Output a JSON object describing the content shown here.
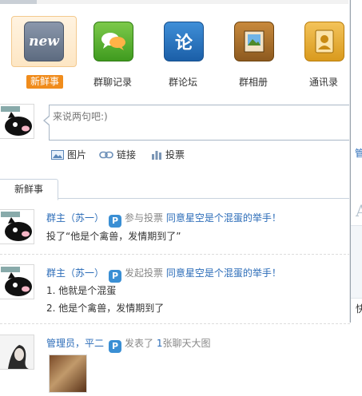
{
  "apps": [
    {
      "label": "新鲜事",
      "icon": "news-icon",
      "icon_text": "new",
      "active": true
    },
    {
      "label": "群聊记录",
      "icon": "chat-bubbles-icon",
      "active": false
    },
    {
      "label": "群论坛",
      "icon": "forum-icon",
      "icon_text": "论",
      "active": false
    },
    {
      "label": "群相册",
      "icon": "photo-album-icon",
      "active": false
    },
    {
      "label": "通讯录",
      "icon": "contacts-book-icon",
      "active": false
    }
  ],
  "composer": {
    "placeholder": "来说两句吧:)",
    "tools": [
      {
        "label": "图片",
        "icon": "image-icon"
      },
      {
        "label": "链接",
        "icon": "link-icon"
      },
      {
        "label": "投票",
        "icon": "poll-icon"
      }
    ]
  },
  "tabs": [
    {
      "label": "新鲜事",
      "active": true
    }
  ],
  "feed": [
    {
      "author": "群主（苏一）",
      "action": "参与投票",
      "target": "同意星空是个混蛋的举手！",
      "lines": [
        "投了“他是个禽兽，发情期到了”"
      ]
    },
    {
      "author": "群主（苏一）",
      "action": "发起投票",
      "target": "同意星空是个混蛋的举手！",
      "lines": [
        "1. 他就是个混蛋",
        "2. 他是个禽兽，发情期到了"
      ]
    },
    {
      "author": "管理员，平二",
      "action": "发表了",
      "count": "1",
      "target": "张聊天大图",
      "lines": []
    }
  ],
  "right_panel": {
    "link": "管",
    "letter": "A",
    "char": "快"
  },
  "colors": {
    "accent": "#f08c1c",
    "link": "#2b6cb8",
    "muted": "#888888"
  }
}
